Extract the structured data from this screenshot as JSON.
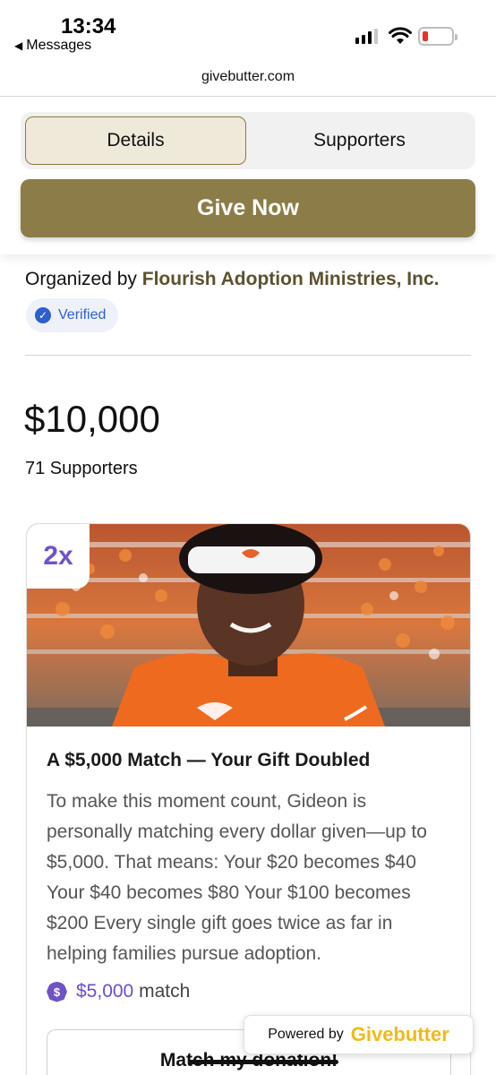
{
  "status_bar": {
    "time": "13:34",
    "back_app": "Messages",
    "back_icon": "triangle-left-icon",
    "signal_bars_on": 3,
    "signal_bars_total": 4,
    "battery_level": 0.15,
    "battery_color": "#e5322b"
  },
  "browser": {
    "url": "givebutter.com"
  },
  "tabs": {
    "details": "Details",
    "supporters": "Supporters",
    "active": "Details"
  },
  "give_button": {
    "label": "Give Now",
    "color": "#8c7d48"
  },
  "organizer": {
    "prefix": "Organized by",
    "name": "Flourish Adoption Ministries, Inc.",
    "verified_label": "Verified"
  },
  "stats": {
    "amount": "$10,000",
    "supporters": "71 Supporters"
  },
  "match_card": {
    "badge": "2x",
    "title": "A $5,000 Match — Your Gift Doubled",
    "description": "To make this moment count, Gideon is personally matching every dollar given—up to $5,000. That means: Your $20 becomes $40 Your $40 becomes $80 Your $100 becomes $200 Every single gift goes twice as far in helping families pursue adoption.",
    "match_icon": "dollar-badge-icon",
    "match_amount": "$5,000",
    "match_suffix": "match",
    "button_label": "Match my donation!",
    "accent": "#7052c7"
  },
  "powered_by": {
    "prefix": "Powered by",
    "brand": "Givebutter",
    "brand_color": "#f2b81c"
  }
}
